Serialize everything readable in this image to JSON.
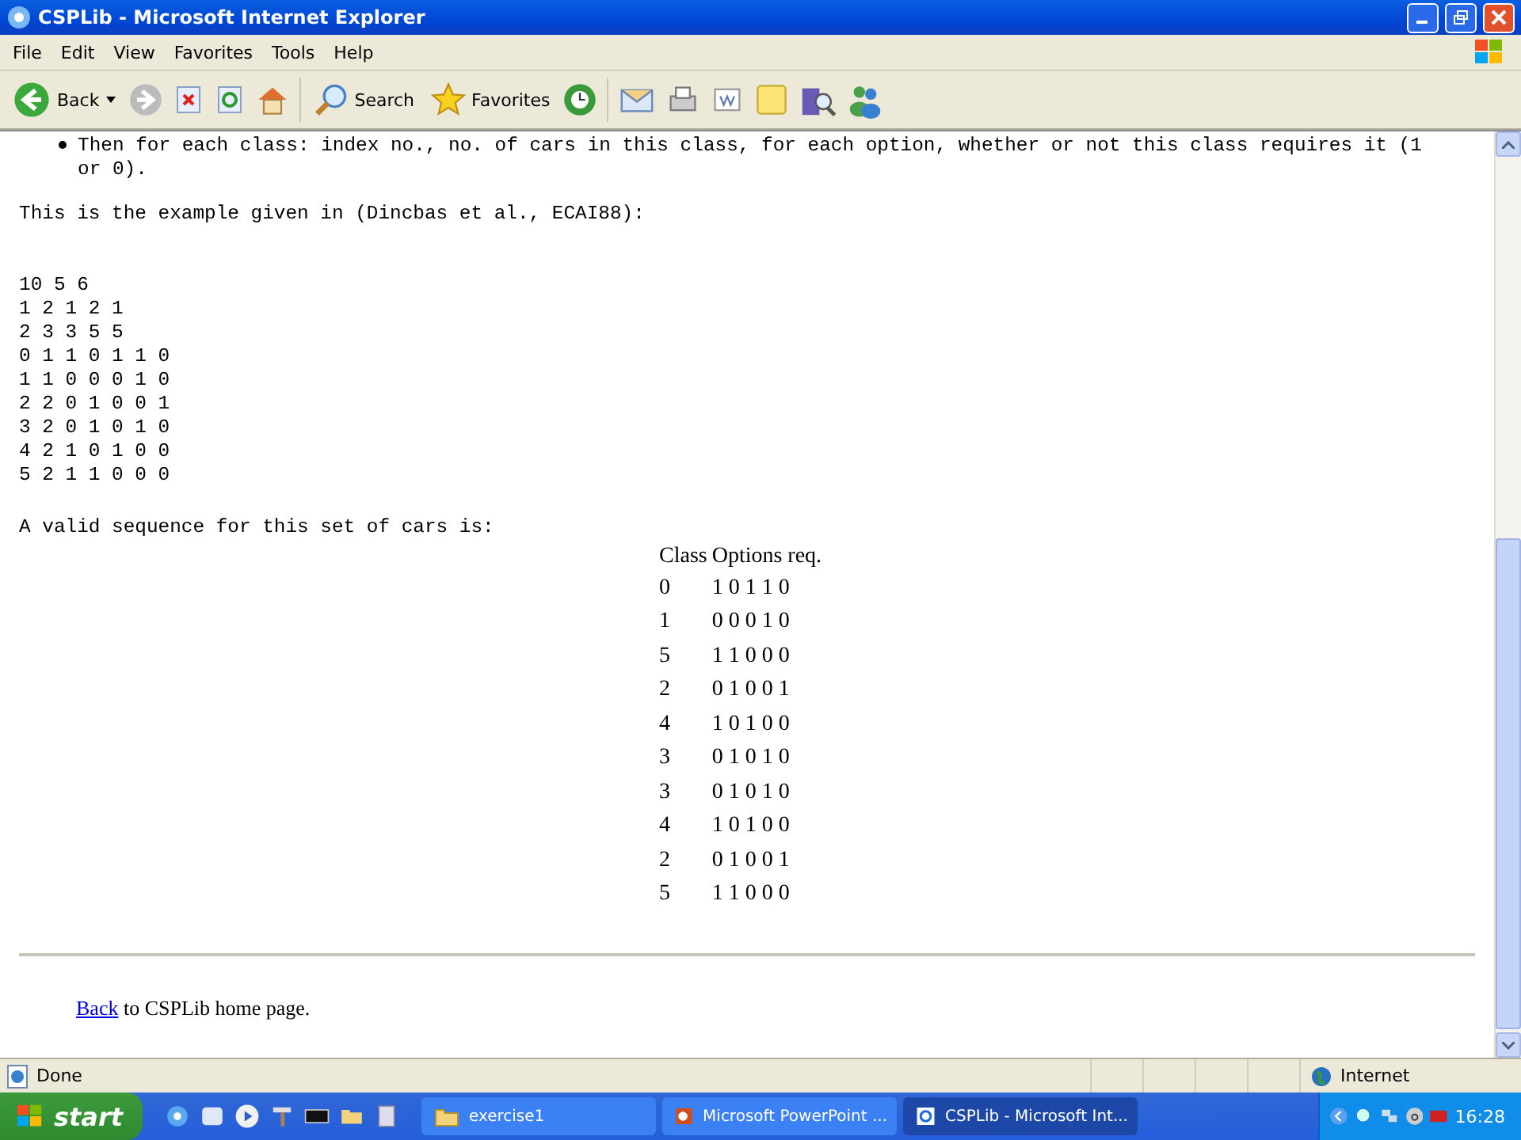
{
  "window": {
    "title": "CSPLib - Microsoft Internet Explorer"
  },
  "menu": [
    "File",
    "Edit",
    "View",
    "Favorites",
    "Tools",
    "Help"
  ],
  "toolbar": {
    "back": "Back",
    "search": "Search",
    "favorites": "Favorites"
  },
  "content": {
    "bullet": "Then for each class: index no., no. of cars in this class, for each option, whether or not this class requires it (1 or 0).",
    "intro": "This is the example given in (Dincbas et al., ECAI88):",
    "data_lines": [
      "10 5 6",
      "1 2 1 2 1",
      "2 3 3 5 5",
      "0 1 1 0 1 1 0",
      "1 1 0 0 0 1 0",
      "2 2 0 1 0 0 1",
      "3 2 0 1 0 1 0",
      "4 2 1 0 1 0 0",
      "5 2 1 1 0 0 0"
    ],
    "sequence_intro": "A valid sequence for this set of cars is:",
    "table": {
      "columns": [
        "Class",
        "Options req."
      ],
      "rows": [
        [
          "0",
          "1 0 1 1 0"
        ],
        [
          "1",
          "0 0 0 1 0"
        ],
        [
          "5",
          "1 1 0 0 0"
        ],
        [
          "2",
          "0 1 0 0 1"
        ],
        [
          "4",
          "1 0 1 0 0"
        ],
        [
          "3",
          "0 1 0 1 0"
        ],
        [
          "3",
          "0 1 0 1 0"
        ],
        [
          "4",
          "1 0 1 0 0"
        ],
        [
          "2",
          "0 1 0 0 1"
        ],
        [
          "5",
          "1 1 0 0 0"
        ]
      ]
    },
    "footer_link": "Back",
    "footer_text": "to CSPLib home page."
  },
  "status_bar": {
    "text": "Done",
    "zone": "Internet"
  },
  "taskbar": {
    "start": "start",
    "tasks": [
      {
        "label": "exercise1",
        "selected": false,
        "kind": "folder"
      },
      {
        "label": "Microsoft PowerPoint ...",
        "selected": false,
        "kind": "powerpoint"
      },
      {
        "label": "CSPLib - Microsoft Int...",
        "selected": true,
        "kind": "browser"
      }
    ],
    "clock": "16:28"
  }
}
